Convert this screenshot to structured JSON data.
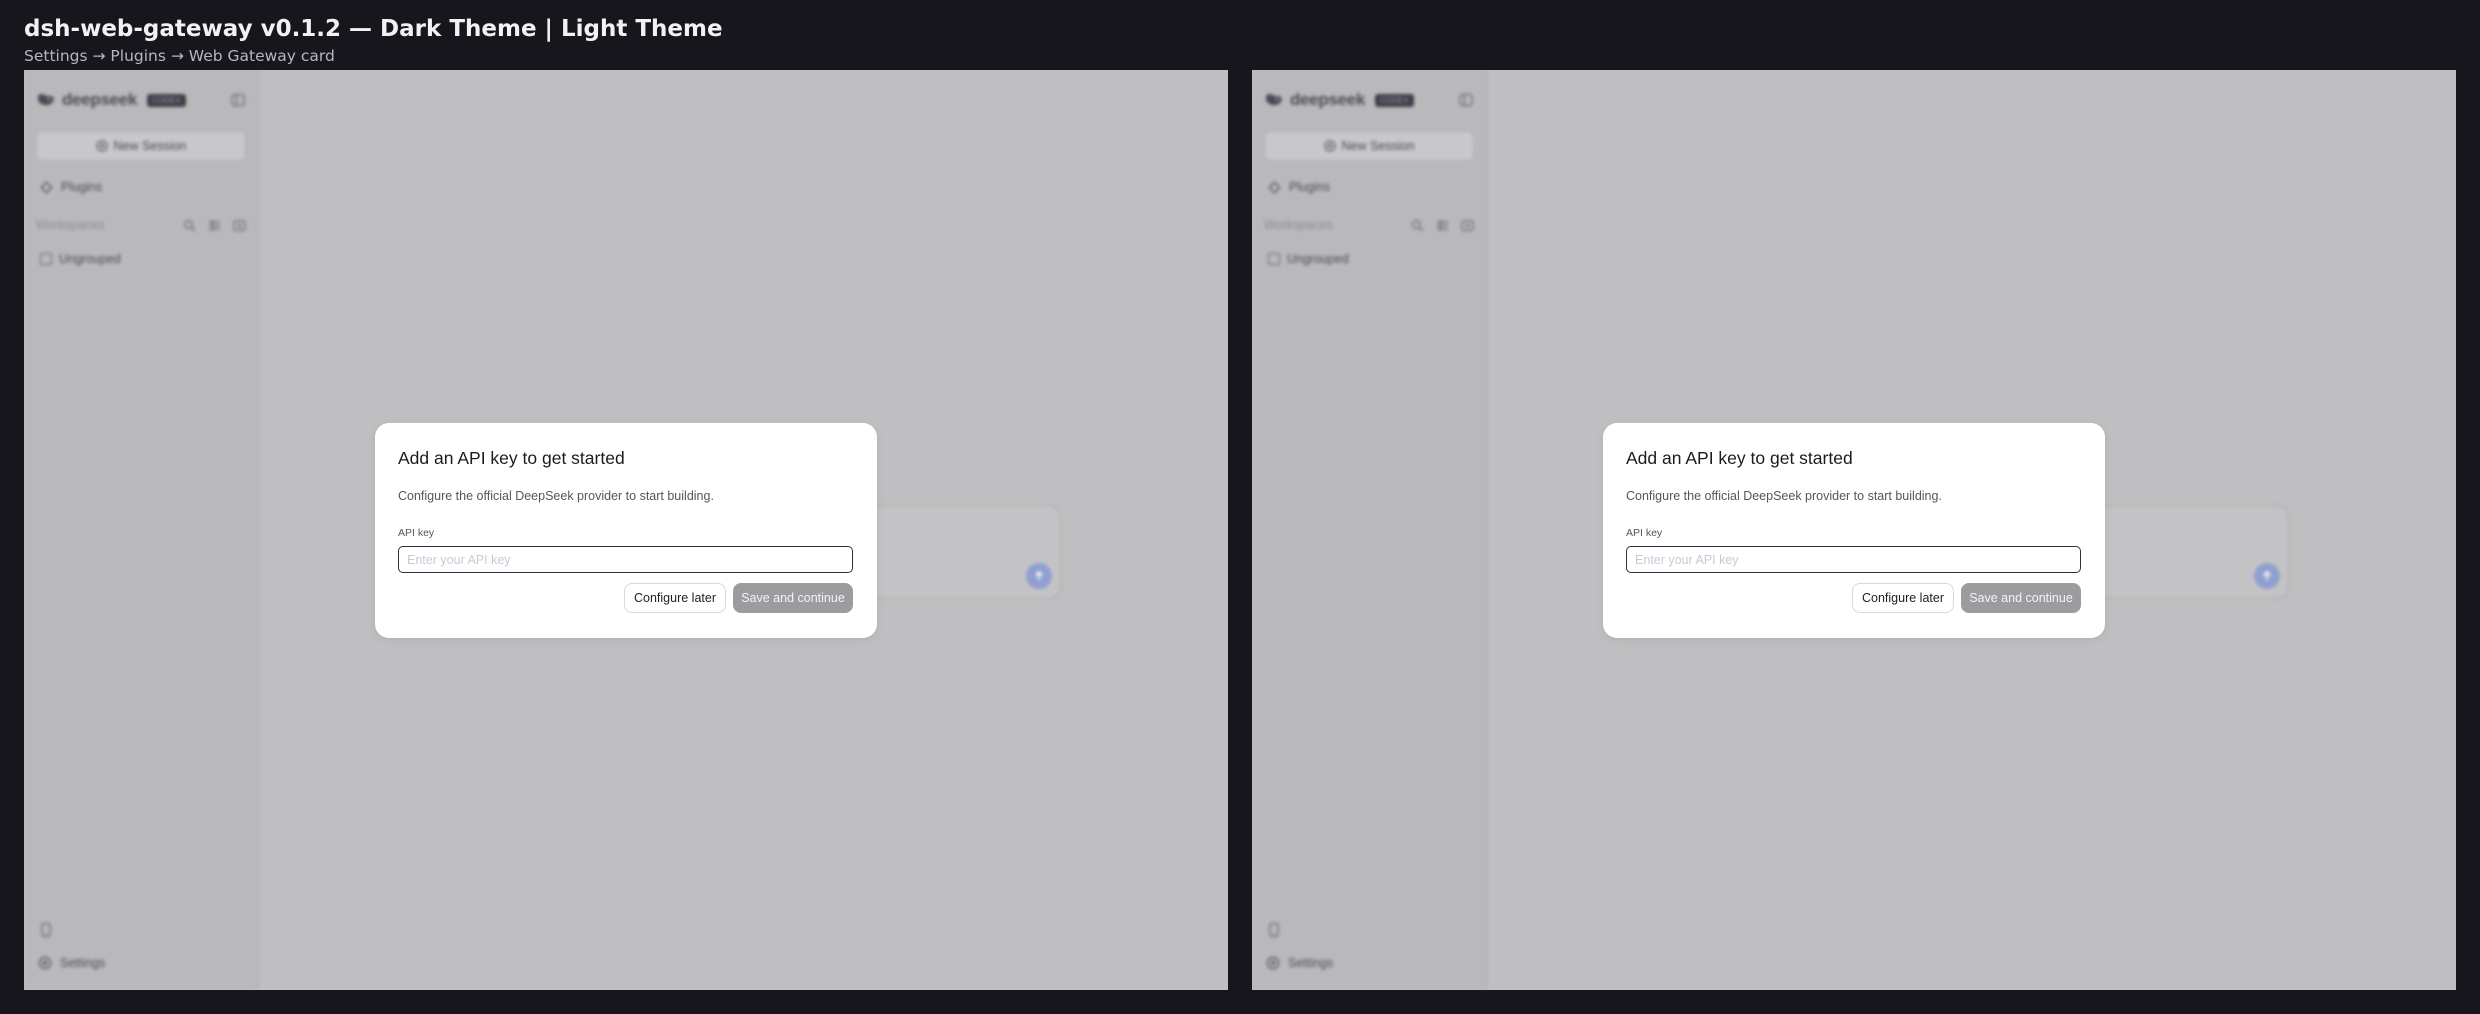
{
  "header": {
    "title": "dsh-web-gateway v0.1.2 — Dark Theme | Light Theme",
    "subtitle": "Settings → Plugins → Web Gateway card"
  },
  "app": {
    "brand_name": "deepseek",
    "brand_badge": "CODEX",
    "new_session_label": "New Session",
    "plugins_label": "Plugins",
    "workspaces_label": "Workspaces",
    "ungrouped_label": "Ungrouped",
    "settings_label": "Settings",
    "send_color": "#8f9fcf"
  },
  "modal": {
    "title": "Add an API key to get started",
    "description": "Configure the official DeepSeek provider to start building.",
    "field_label": "API key",
    "input_placeholder": "Enter your API key",
    "input_value": "",
    "configure_later_label": "Configure later",
    "save_label": "Save and continue",
    "save_enabled": false
  },
  "panels": [
    {
      "theme": "Dark Theme"
    },
    {
      "theme": "Light Theme"
    }
  ],
  "colors": {
    "page_background": "#17161d",
    "panel_background": "#bfbfc1",
    "modal_background": "#ffffff",
    "save_button_disabled": "#9c9c9f"
  }
}
